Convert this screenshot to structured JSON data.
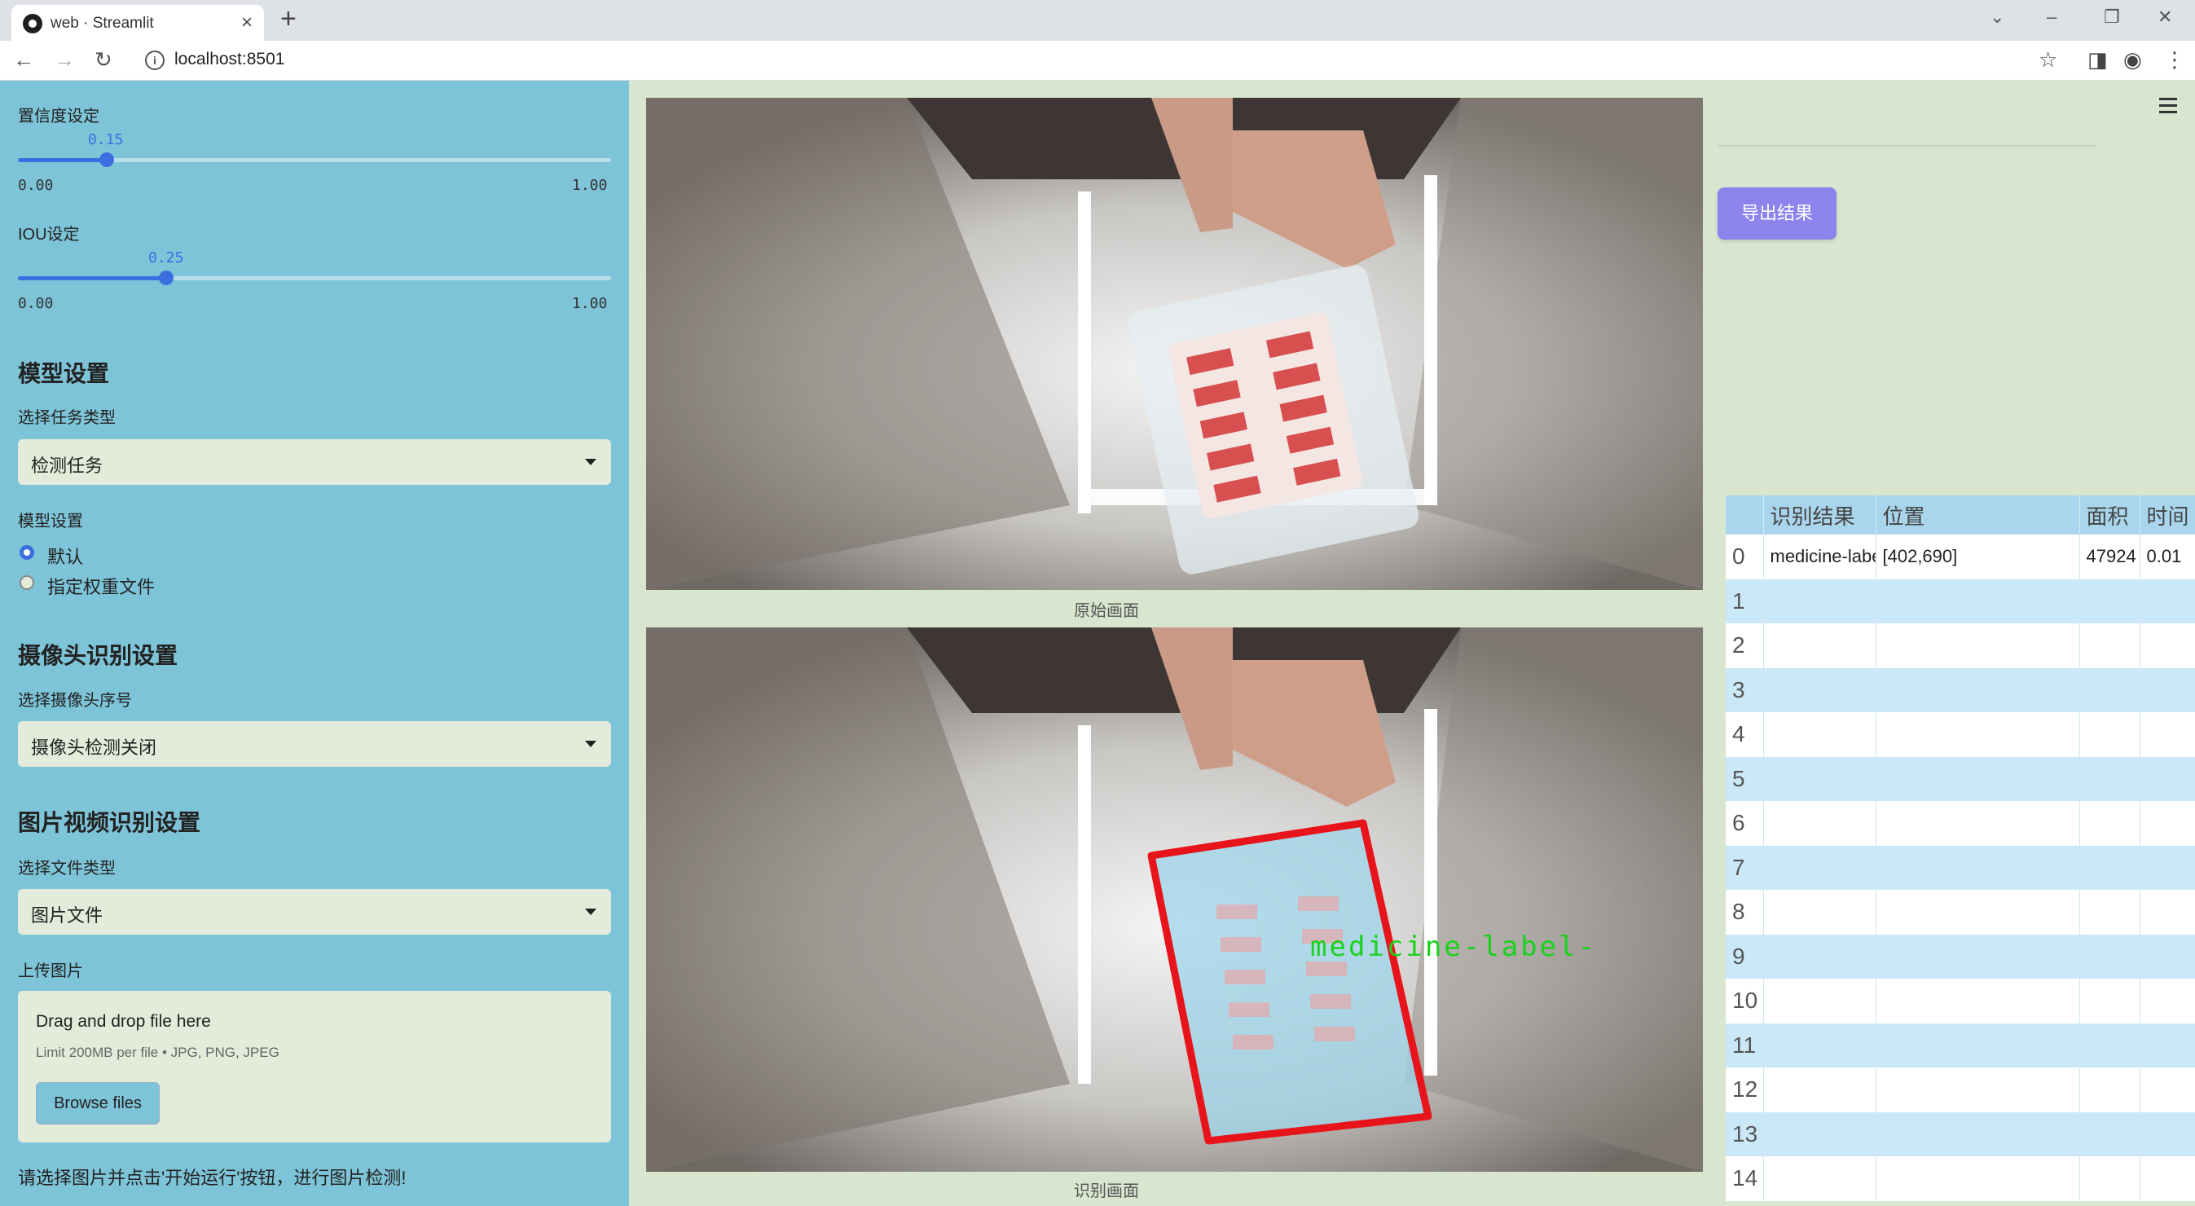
{
  "browser": {
    "tab_title": "web · Streamlit",
    "url": "localhost:8501"
  },
  "sidebar": {
    "confidence": {
      "label": "置信度设定",
      "value": "0.15",
      "min": "0.00",
      "max": "1.00",
      "fraction": 0.15
    },
    "iou": {
      "label": "IOU设定",
      "value": "0.25",
      "min": "0.00",
      "max": "1.00",
      "fraction": 0.25
    },
    "model_heading": "模型设置",
    "task_type_label": "选择任务类型",
    "task_type_value": "检测任务",
    "model_setting_label": "模型设置",
    "model_options": [
      {
        "label": "默认",
        "checked": true
      },
      {
        "label": "指定权重文件",
        "checked": false
      }
    ],
    "camera_heading": "摄像头识别设置",
    "camera_label": "选择摄像头序号",
    "camera_value": "摄像头检测关闭",
    "media_heading": "图片视频识别设置",
    "file_type_label": "选择文件类型",
    "file_type_value": "图片文件",
    "upload_label": "上传图片",
    "upload_title": "Drag and drop file here",
    "upload_limit": "Limit 200MB per file • JPG, PNG, JPEG",
    "browse_button": "Browse files",
    "hint": "请选择图片并点击'开始运行'按钮，进行图片检测!"
  },
  "main": {
    "original_caption": "原始画面",
    "detected_caption": "识别画面",
    "detection_label": "medicine-label-"
  },
  "right": {
    "export_button": "导出结果",
    "table": {
      "headers": [
        "",
        "识别结果",
        "位置",
        "面积",
        "时间"
      ],
      "rows": [
        {
          "index": "0",
          "result": "medicine-label",
          "position": "[402,690]",
          "area": "47924",
          "time": "0.01"
        },
        {
          "index": "1",
          "result": "",
          "position": "",
          "area": "",
          "time": ""
        },
        {
          "index": "2",
          "result": "",
          "position": "",
          "area": "",
          "time": ""
        },
        {
          "index": "3",
          "result": "",
          "position": "",
          "area": "",
          "time": ""
        },
        {
          "index": "4",
          "result": "",
          "position": "",
          "area": "",
          "time": ""
        },
        {
          "index": "5",
          "result": "",
          "position": "",
          "area": "",
          "time": ""
        },
        {
          "index": "6",
          "result": "",
          "position": "",
          "area": "",
          "time": ""
        },
        {
          "index": "7",
          "result": "",
          "position": "",
          "area": "",
          "time": ""
        },
        {
          "index": "8",
          "result": "",
          "position": "",
          "area": "",
          "time": ""
        },
        {
          "index": "9",
          "result": "",
          "position": "",
          "area": "",
          "time": ""
        },
        {
          "index": "10",
          "result": "",
          "position": "",
          "area": "",
          "time": ""
        },
        {
          "index": "11",
          "result": "",
          "position": "",
          "area": "",
          "time": ""
        },
        {
          "index": "12",
          "result": "",
          "position": "",
          "area": "",
          "time": ""
        },
        {
          "index": "13",
          "result": "",
          "position": "",
          "area": "",
          "time": ""
        },
        {
          "index": "14",
          "result": "",
          "position": "",
          "area": "",
          "time": ""
        }
      ]
    }
  },
  "icons": [
    "streamlit-favicon",
    "close-icon",
    "plus-icon",
    "back-icon",
    "forward-icon",
    "reload-icon",
    "info-icon",
    "star-icon",
    "sidepanel-icon",
    "profile-icon",
    "kebab-menu-icon",
    "hamburger-menu-icon",
    "chevron-down-icon"
  ],
  "colors": {
    "sidebar": "#7ec4d8",
    "accent": "#3b6fe0",
    "export_button": "#8c83ec",
    "box": "#e8141c",
    "label": "#19d21e"
  }
}
